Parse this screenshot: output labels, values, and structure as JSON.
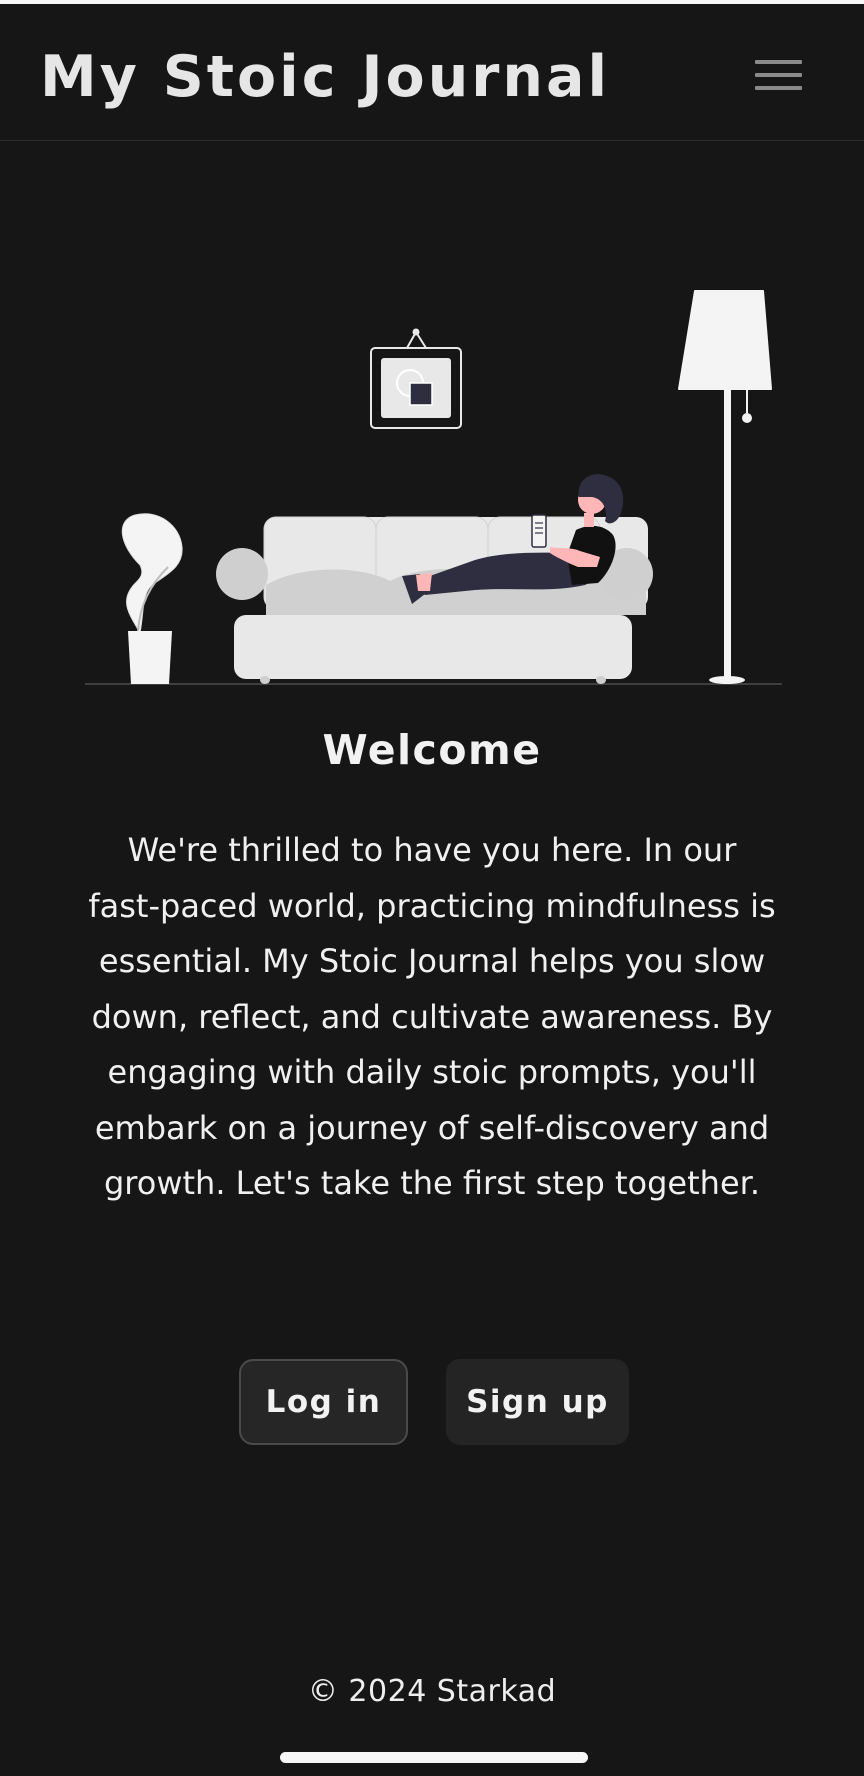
{
  "header": {
    "title": "My Stoic Journal",
    "menu_icon": "hamburger-menu-icon"
  },
  "hero": {
    "illustration": "woman-reading-on-sofa-illustration"
  },
  "main": {
    "heading": "Welcome",
    "intro": "We're thrilled to have you here. In our fast-paced world, practicing mindfulness is essential. My Stoic Journal helps you slow down, reflect, and cultivate awareness. By engaging with daily stoic prompts, you'll embark on a journey of self-discovery and growth. Let's take the first step together."
  },
  "actions": {
    "login_label": "Log in",
    "signup_label": "Sign up"
  },
  "footer": {
    "copyright": "© 2024 Starkad"
  },
  "colors": {
    "background": "#161616",
    "text": "#f2f2f2",
    "button_background": "#262626",
    "illustration_light": "#e8e8e8",
    "illustration_dark": "#2f2e41",
    "skin": "#ffb6b6"
  }
}
